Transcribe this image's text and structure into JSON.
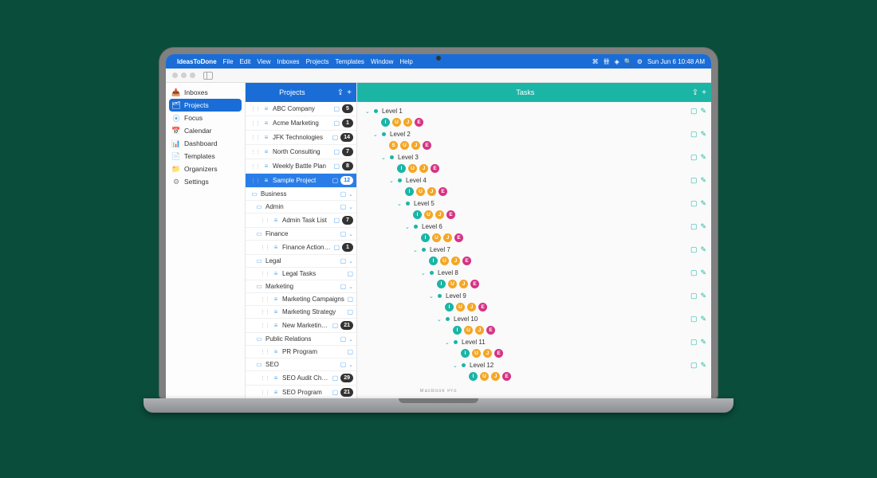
{
  "menubar": {
    "app": "IdeasToDone",
    "items": [
      "File",
      "Edit",
      "View",
      "Inboxes",
      "Projects",
      "Templates",
      "Window",
      "Help"
    ],
    "clock": "Sun Jun 6  10:48 AM"
  },
  "sidebar": {
    "items": [
      {
        "label": "Inboxes",
        "icon": "📥",
        "color": "#57a8f0"
      },
      {
        "label": "Projects",
        "icon": "🗂",
        "color": "#fff",
        "selected": true
      },
      {
        "label": "Focus",
        "icon": "⦿",
        "color": "#57a8f0"
      },
      {
        "label": "Calendar",
        "icon": "📅",
        "color": "#f5a623"
      },
      {
        "label": "Dashboard",
        "icon": "📊",
        "color": "#57a8f0"
      },
      {
        "label": "Templates",
        "icon": "📄",
        "color": "#57a8f0"
      },
      {
        "label": "Organizers",
        "icon": "📁",
        "color": "#f5a623"
      },
      {
        "label": "Settings",
        "icon": "⚙",
        "color": "#888"
      }
    ]
  },
  "projects": {
    "header": "Projects",
    "items": [
      {
        "name": "ABC Company",
        "type": "list",
        "badge": "5"
      },
      {
        "name": "Acme Marketing",
        "type": "list",
        "badge": "1"
      },
      {
        "name": "JFK Technologies",
        "type": "list",
        "badge": "14"
      },
      {
        "name": "North Consulting",
        "type": "list",
        "badge": "7"
      },
      {
        "name": "Weekly Battle Plan",
        "type": "list",
        "badge": "8"
      },
      {
        "name": "Sample Project",
        "type": "list",
        "badge": "12",
        "selected": true
      },
      {
        "name": "Business",
        "type": "folder",
        "chev": true
      },
      {
        "name": "Admin",
        "type": "folder",
        "indent": 1,
        "chev": true
      },
      {
        "name": "Admin Task List",
        "type": "list",
        "indent": 2,
        "badge": "7"
      },
      {
        "name": "Finance",
        "type": "folder",
        "indent": 1,
        "chev": true
      },
      {
        "name": "Finance Action Plan",
        "type": "list",
        "indent": 2,
        "badge": "1"
      },
      {
        "name": "Legal",
        "type": "folder",
        "indent": 1,
        "chev": true
      },
      {
        "name": "Legal Tasks",
        "type": "list",
        "indent": 2
      },
      {
        "name": "Marketing",
        "type": "folder",
        "indent": 1,
        "chev": true
      },
      {
        "name": "Marketing Campaigns",
        "type": "list",
        "indent": 2
      },
      {
        "name": "Marketing Strategy",
        "type": "list",
        "indent": 2
      },
      {
        "name": "New Marketing Campaign",
        "type": "list",
        "indent": 2,
        "badge": "21"
      },
      {
        "name": "Public Relations",
        "type": "folder",
        "indent": 1,
        "chev": true
      },
      {
        "name": "PR Program",
        "type": "list",
        "indent": 2
      },
      {
        "name": "SEO",
        "type": "folder",
        "indent": 1,
        "chev": true
      },
      {
        "name": "SEO Audit Checklist",
        "type": "list",
        "indent": 2,
        "badge": "29"
      },
      {
        "name": "SEO Program",
        "type": "list",
        "indent": 2,
        "badge": "21"
      }
    ]
  },
  "tasks": {
    "header": "Tasks",
    "levels": [
      {
        "label": "Level 1",
        "chips": [
          "I",
          "U",
          "J",
          "E"
        ]
      },
      {
        "label": "Level 2",
        "chips": [
          "S",
          "U",
          "J",
          "E"
        ]
      },
      {
        "label": "Level 3",
        "chips": [
          "I",
          "U",
          "J",
          "E"
        ]
      },
      {
        "label": "Level 4",
        "chips": [
          "I",
          "U",
          "J",
          "E"
        ]
      },
      {
        "label": "Level 5",
        "chips": [
          "I",
          "U",
          "J",
          "E"
        ]
      },
      {
        "label": "Level 6",
        "chips": [
          "I",
          "U",
          "J",
          "E"
        ]
      },
      {
        "label": "Level 7",
        "chips": [
          "I",
          "U",
          "J",
          "E"
        ]
      },
      {
        "label": "Level 8",
        "chips": [
          "I",
          "U",
          "J",
          "E"
        ]
      },
      {
        "label": "Level 9",
        "chips": [
          "I",
          "U",
          "J",
          "E"
        ]
      },
      {
        "label": "Level 10",
        "chips": [
          "I",
          "U",
          "J",
          "E"
        ]
      },
      {
        "label": "Level 11",
        "chips": [
          "I",
          "U",
          "J",
          "E"
        ]
      },
      {
        "label": "Level 12",
        "chips": [
          "I",
          "U",
          "J",
          "E"
        ]
      }
    ]
  },
  "laptop_label": "MacBook Pro"
}
